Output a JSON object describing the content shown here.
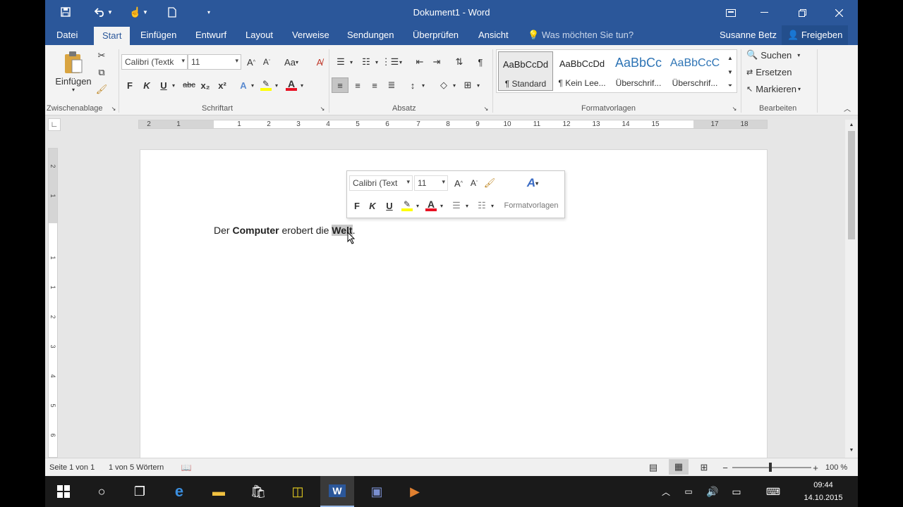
{
  "titlebar": {
    "title": "Dokument1 - Word",
    "quick_access": [
      "save-icon",
      "undo-icon",
      "touch-mode-icon",
      "new-document-icon",
      "customize-icon"
    ],
    "window_buttons": [
      "ribbon-display-icon",
      "minimize-icon",
      "restore-icon",
      "close-icon"
    ]
  },
  "tabs": {
    "file": "Datei",
    "items": [
      "Start",
      "Einfügen",
      "Entwurf",
      "Layout",
      "Verweise",
      "Sendungen",
      "Überprüfen",
      "Ansicht"
    ],
    "tell_me": "Was möchten Sie tun?",
    "user": "Susanne Betz",
    "share": "Freigeben"
  },
  "ribbon": {
    "clipboard": {
      "paste": "Einfügen",
      "label": "Zwischenablage"
    },
    "font": {
      "name": "Calibri (Textk",
      "size": "11",
      "label": "Schriftart",
      "case": "Aa",
      "bold": "F",
      "italic": "K",
      "underline": "U",
      "strike": "abc",
      "sub": "x₂",
      "sup": "x²"
    },
    "paragraph": {
      "label": "Absatz"
    },
    "styles": {
      "label": "Formatvorlagen",
      "items": [
        {
          "preview": "AaBbCcDd",
          "name": "¶ Standard"
        },
        {
          "preview": "AaBbCcDd",
          "name": "¶ Kein Lee..."
        },
        {
          "preview": "AaBbCc",
          "name": "Überschrif..."
        },
        {
          "preview": "AaBbCcC",
          "name": "Überschrif..."
        }
      ]
    },
    "editing": {
      "search": "Suchen",
      "replace": "Ersetzen",
      "select": "Markieren",
      "label": "Bearbeiten"
    }
  },
  "ruler": {
    "numbers": [
      "2",
      "1",
      "1",
      "1",
      "2",
      "3",
      "4",
      "5",
      "6",
      "7",
      "8",
      "9",
      "10",
      "11",
      "12",
      "13",
      "14",
      "15",
      "17",
      "18"
    ]
  },
  "vruler": {
    "numbers": [
      "2",
      "1",
      "1",
      "1",
      "2",
      "3",
      "4",
      "5",
      "6"
    ]
  },
  "mini_toolbar": {
    "font": "Calibri (Text",
    "size": "11",
    "bold": "F",
    "italic": "K",
    "underline": "U",
    "styles": "Formatvorlagen"
  },
  "document": {
    "word1": "Der ",
    "word2": "Computer",
    "word3": " erobert die ",
    "word4": "Welt",
    "word5": "."
  },
  "status": {
    "page": "Seite 1 von 1",
    "words": "1 von 5 Wörtern",
    "zoom": "100 %"
  },
  "taskbar": {
    "time": "09:44",
    "date": "14.10.2015"
  },
  "colors": {
    "word_blue": "#2b579a",
    "font_red": "#e81123",
    "highlight_yellow": "#ffff00"
  }
}
